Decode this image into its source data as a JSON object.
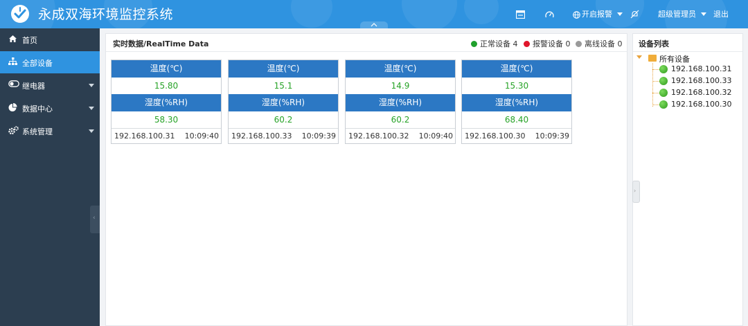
{
  "header": {
    "title": "永成双海环境监控系统",
    "alarm_menu_label": "开启报警",
    "user_label": "超级管理员",
    "logout_label": "退出",
    "icons": [
      "logo-icon",
      "window-icon",
      "dashboard-icon",
      "globe-icon",
      "bell-off-icon"
    ],
    "colors": {
      "bar": "#2f93e0"
    }
  },
  "sidebar": {
    "items": [
      {
        "label": "首页",
        "icon": "home-icon",
        "active": false,
        "has_submenu": false
      },
      {
        "label": "全部设备",
        "icon": "sitemap-icon",
        "active": true,
        "has_submenu": false
      },
      {
        "label": "继电器",
        "icon": "toggle-icon",
        "active": false,
        "has_submenu": true
      },
      {
        "label": "数据中心",
        "icon": "pie-chart-icon",
        "active": false,
        "has_submenu": true
      },
      {
        "label": "系统管理",
        "icon": "gears-icon",
        "active": false,
        "has_submenu": true
      }
    ],
    "collapse_glyph": "‹",
    "colors": {
      "background": "#2c3e50",
      "active": "#2f93e0"
    }
  },
  "main": {
    "title": "实时数据/RealTime Data",
    "legend": [
      {
        "label": "正常设备 4",
        "color": "#1fa02b"
      },
      {
        "label": "报警设备 0",
        "color": "#e0162b"
      },
      {
        "label": "离线设备 0",
        "color": "#9a9a9a"
      }
    ],
    "devices": [
      {
        "temp_label": "温度(℃)",
        "temp_value": "15.80",
        "humidity_label": "湿度(%RH)",
        "humidity_value": "58.30",
        "ip": "192.168.100.31",
        "time": "10:09:40"
      },
      {
        "temp_label": "温度(℃)",
        "temp_value": "15.1",
        "humidity_label": "湿度(%RH)",
        "humidity_value": "60.2",
        "ip": "192.168.100.33",
        "time": "10:09:39"
      },
      {
        "temp_label": "温度(℃)",
        "temp_value": "14.9",
        "humidity_label": "湿度(%RH)",
        "humidity_value": "60.2",
        "ip": "192.168.100.32",
        "time": "10:09:40"
      },
      {
        "temp_label": "温度(℃)",
        "temp_value": "15.30",
        "humidity_label": "湿度(%RH)",
        "humidity_value": "68.40",
        "ip": "192.168.100.30",
        "time": "10:09:39"
      }
    ],
    "colors": {
      "card_header": "#2c78c4",
      "value_text": "#27a327"
    }
  },
  "device_list": {
    "title": "设备列表",
    "root_label": "所有设备",
    "nodes": [
      "192.168.100.31",
      "192.168.100.33",
      "192.168.100.32",
      "192.168.100.30"
    ],
    "expand_glyph": "›"
  }
}
